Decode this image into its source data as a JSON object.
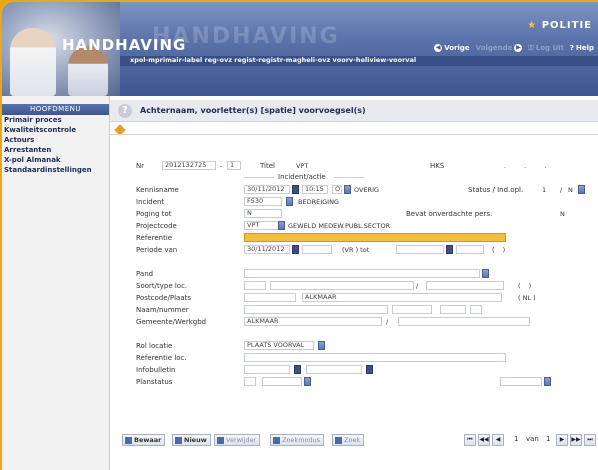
{
  "app": {
    "title": "HANDHAVING",
    "title_ghost": "HANDHAVING",
    "logo": "POLITIE"
  },
  "topnav": {
    "prev": "Vorige",
    "next": "Volgende",
    "login": "Log Uit",
    "help": "Help"
  },
  "menubar": "xpol-mprimair-label reg-ovz regist-registr-magheli-ovz voorv-heliview-voorval",
  "sidebar": {
    "header": "HOOFDMENU",
    "items": [
      {
        "label": "Primair proces"
      },
      {
        "label": "Kwaliteitscontrole"
      },
      {
        "label": "Actours"
      },
      {
        "label": "Arrestanten"
      },
      {
        "label": "X-pol Almanak"
      },
      {
        "label": "Standaardinstellingen"
      }
    ]
  },
  "search": {
    "help_icon": "?",
    "text": "Achternaam, voorletter(s) [spatie] voorvoegsel(s)"
  },
  "form": {
    "nr_label": "Nr",
    "nr_value": "2012132725",
    "nr_sep": "-",
    "nr_suffix": "1",
    "titel_label": "Titel",
    "titel_value": "VPT",
    "hks_label": "HKS",
    "hks_dots": ". . .",
    "section_title": "Incident/actie",
    "kennisname_label": "Kennisname",
    "kennisname_date": "30/11/2012",
    "kennisname_time": "10:15",
    "kennisname_code": "O",
    "kennisname_type": "OVERIG",
    "status_label": "Status / Ind.opl.",
    "status_value": "1",
    "status_sep": "/",
    "status_ind": "N",
    "incident_label": "Incident",
    "incident_code": "F530",
    "incident_desc": "BEDREIGING",
    "poging_label": "Poging tot",
    "poging_value": "N",
    "bevat_label": "Bevat onverdachte pers.",
    "bevat_value": "N",
    "projectcode_label": "Projectcode",
    "projectcode_code": "VPT",
    "projectcode_desc": "GEWELD MEDEW.PUBL.SECTOR",
    "referentie_label": "Referentie",
    "referentie_value": "",
    "periode_label": "Periode van",
    "periode_date": "30/11/2012",
    "periode_vr": "(VR ) tot",
    "periode_paren": "(   )",
    "pand_label": "Pand",
    "soort_label": "Soort/type loc.",
    "soort_slash": "/",
    "soort_paren": "(   )",
    "postcode_label": "Postcode/Plaats",
    "postcode_plaats": "ALKMAAR",
    "postcode_nl": "( NL )",
    "naam_label": "Naam/nummer",
    "gemeente_label": "Gemeente/Werkgbd",
    "gemeente_value": "ALKMAAR",
    "gemeente_slash": "/",
    "rol_label": "Rol locatie",
    "rol_value": "PLAATS VOORVAL",
    "refloc_label": "Referentie loc.",
    "infobulletin_label": "Infobulletin",
    "planstatus_label": "Planstatus"
  },
  "toolbar": {
    "bewaar": "Bewaar",
    "nieuw": "Nieuw",
    "verwijder": "Verwijder",
    "zoekmodus": "Zoekmodus",
    "zoek": "Zoek"
  },
  "pager": {
    "first": "⏮",
    "prev10": "◀◀",
    "prev": "◀",
    "current": "1",
    "of_label": "van",
    "total": "1",
    "next": "▶",
    "next10": "▶▶",
    "last": "⏭"
  }
}
